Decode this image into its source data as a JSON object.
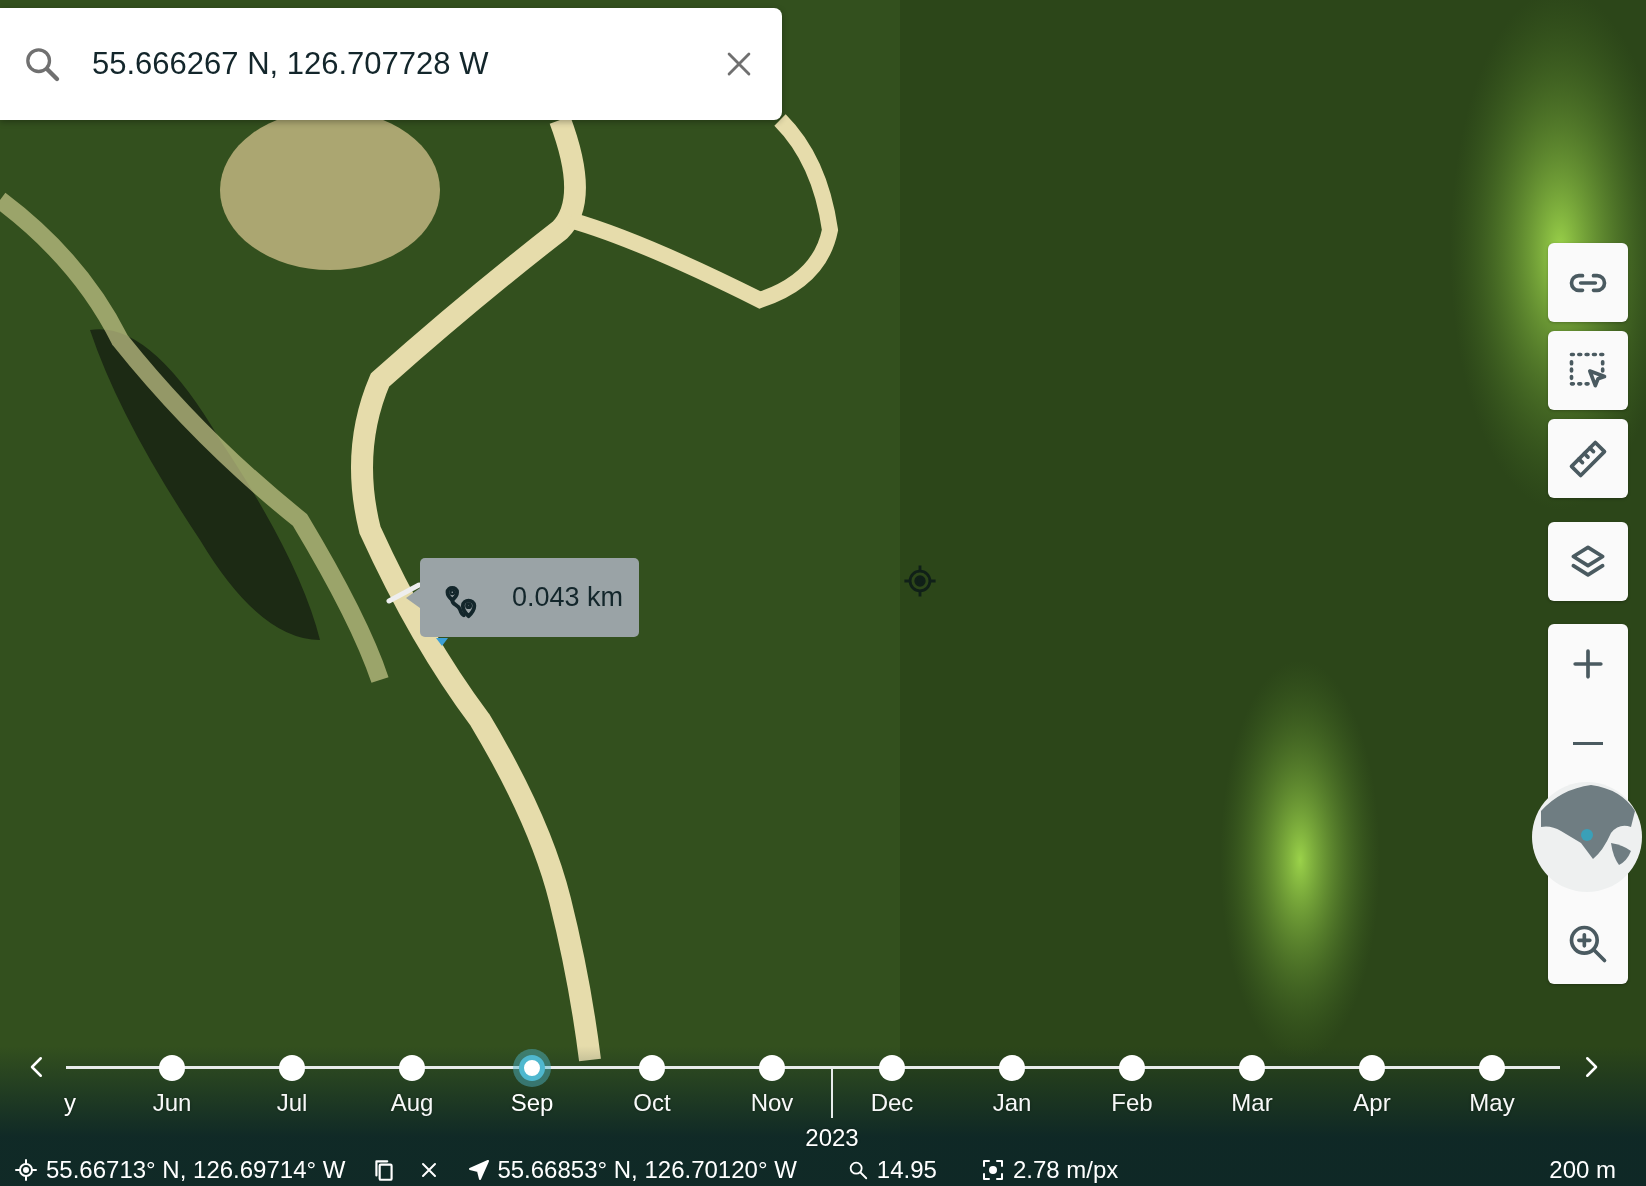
{
  "search": {
    "value": "55.666267 N, 126.707728 W"
  },
  "measurement": {
    "distance": "0.043 km"
  },
  "timeline": {
    "months": [
      {
        "kind": "cut",
        "label": "y"
      },
      {
        "kind": "month",
        "label": "Jun",
        "selected": false
      },
      {
        "kind": "month",
        "label": "Jul",
        "selected": false
      },
      {
        "kind": "month",
        "label": "Aug",
        "selected": false
      },
      {
        "kind": "month",
        "label": "Sep",
        "selected": true
      },
      {
        "kind": "month",
        "label": "Oct",
        "selected": false
      },
      {
        "kind": "month",
        "label": "Nov",
        "selected": false
      },
      {
        "kind": "month",
        "label": "Dec",
        "selected": false,
        "year": "2023"
      },
      {
        "kind": "month",
        "label": "Jan",
        "selected": false
      },
      {
        "kind": "month",
        "label": "Feb",
        "selected": false
      },
      {
        "kind": "month",
        "label": "Mar",
        "selected": false
      },
      {
        "kind": "month",
        "label": "Apr",
        "selected": false
      },
      {
        "kind": "month",
        "label": "May",
        "selected": false
      }
    ]
  },
  "status_bar": {
    "cursor": "55.66713° N, 126.69714° W",
    "location": "55.66853° N, 126.70120° W",
    "zoom": "14.95",
    "resolution": "2.78 m/px",
    "scale": "200 m"
  }
}
